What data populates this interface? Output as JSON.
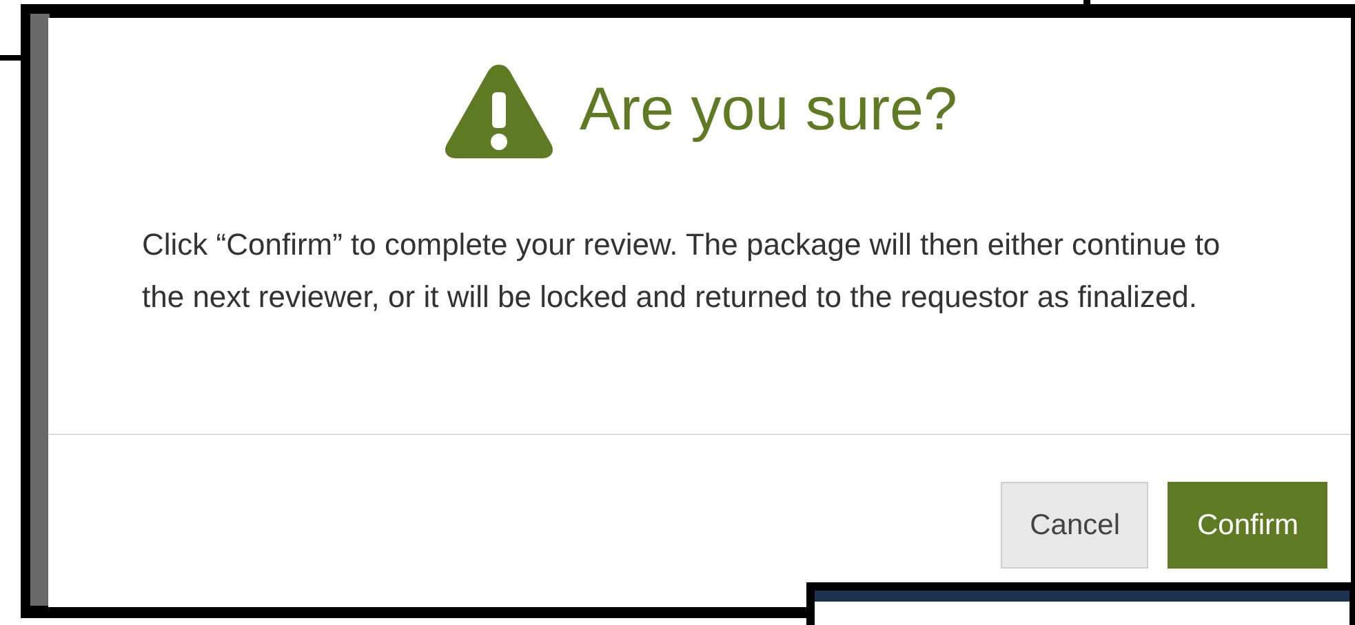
{
  "dialog": {
    "title": "Are you sure?",
    "message": "Click “Confirm” to complete your review. The package will then either continue to the next reviewer, or it will be locked and returned to the requestor as finalized.",
    "buttons": [
      {
        "label": "Cancel",
        "kind": "secondary"
      },
      {
        "label": "Confirm",
        "kind": "primary"
      }
    ]
  }
}
